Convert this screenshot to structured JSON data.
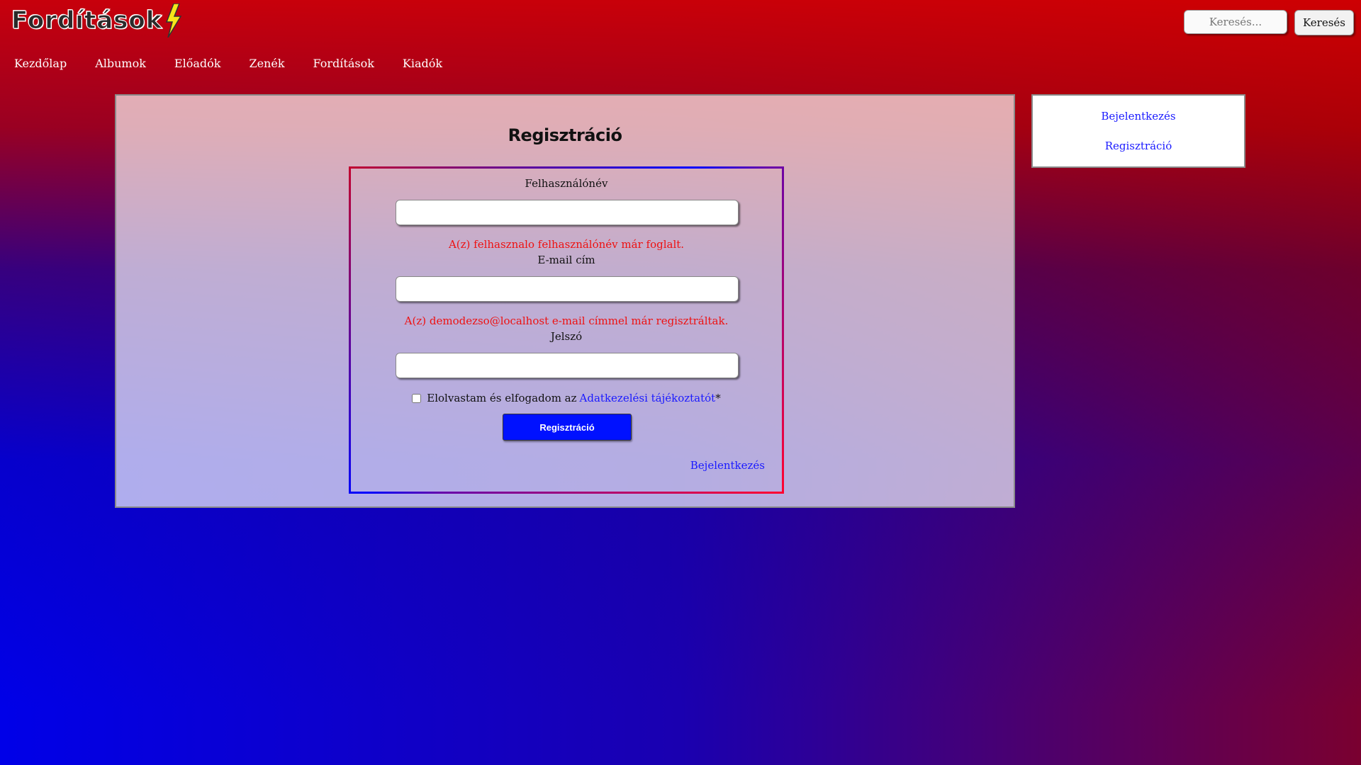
{
  "header": {
    "logo_text": "Fordítások",
    "search_placeholder": "Keresés...",
    "search_button_label": "Keresés"
  },
  "nav": {
    "items": [
      {
        "label": "Kezdőlap"
      },
      {
        "label": "Albumok"
      },
      {
        "label": "Előadók"
      },
      {
        "label": "Zenék"
      },
      {
        "label": "Fordítások"
      },
      {
        "label": "Kiadók"
      }
    ]
  },
  "main": {
    "title": "Regisztráció",
    "form": {
      "username_label": "Felhasználónév",
      "username_value": "",
      "username_error": "A(z) felhasznalo felhasználónév már foglalt.",
      "email_label": "E-mail cím",
      "email_value": "",
      "email_error": "A(z) demodezso@localhost e-mail címmel már regisztráltak.",
      "password_label": "Jelszó",
      "password_value": "",
      "consent_text": "Elolvastam és elfogadom az",
      "consent_link": "Adatkezelési tájékoztatót",
      "consent_required_mark": "*",
      "consent_checked": false,
      "submit_label": "Regisztráció",
      "login_link": "Bejelentkezés"
    }
  },
  "sidebar": {
    "login_link": "Bejelentkezés",
    "register_link": "Regisztráció"
  },
  "colors": {
    "accent_blue": "#0011ff",
    "error_red": "#ee1111",
    "link_blue": "#1a1aff",
    "logo_bolt": "#f5e61a"
  },
  "icons": {
    "logo_bolt": "lightning-bolt-icon"
  }
}
